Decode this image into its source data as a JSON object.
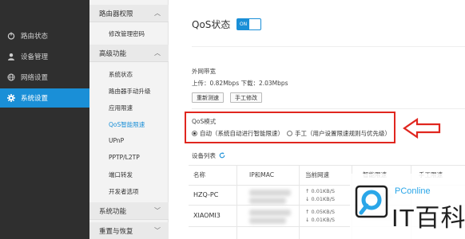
{
  "leftnav": {
    "items": [
      {
        "label": "路由状态",
        "icon": "power-icon"
      },
      {
        "label": "设备管理",
        "icon": "user-icon"
      },
      {
        "label": "网络设置",
        "icon": "globe-icon"
      },
      {
        "label": "系统设置",
        "icon": "gear-icon",
        "active": true
      }
    ],
    "active_color": "#1a8fd7"
  },
  "subnav": {
    "sections": [
      {
        "label": "路由器权限",
        "chevron": "up"
      },
      {
        "label": "高级功能",
        "chevron": "up"
      },
      {
        "label": "系统功能",
        "chevron": "down"
      },
      {
        "label": "重置与恢复",
        "chevron": "down"
      }
    ],
    "items": [
      "修改管理密码",
      "系统状态",
      "路由器手动升级",
      "应用限速",
      "QoS智能限速",
      "UPnP",
      "PPTP/L2TP",
      "端口转发",
      "开发者选项"
    ],
    "active_item": "QoS智能限速"
  },
  "main": {
    "title": "QoS状态",
    "toggle_label": "ON",
    "bandwidth": {
      "label": "外网带宽",
      "values": "上传：0.82Mbps 下载：2.03Mbps",
      "btn_retest": "重新测速",
      "btn_manual": "手工修改"
    },
    "mode": {
      "label": "QoS模式",
      "auto": "自动（系统自动进行智能限速）",
      "manual": "手工（用户设置限速规则与优先级）",
      "selected": "auto"
    },
    "devices": {
      "label": "设备列表",
      "headers": [
        "名称",
        "IP和MAC",
        "当前网速",
        "智能限速",
        "手工限速"
      ],
      "rows": [
        {
          "name": "HZQ-PC",
          "up": "↑ 0.01KB/S",
          "down": "↓ 0.01KB/S"
        },
        {
          "name": "XIAOMI3",
          "up": "↑ 0.05KB/S",
          "down": "↓ 0.01KB/S"
        }
      ]
    }
  },
  "annotation_color": "#e0261f",
  "watermark": {
    "brand": "PConline",
    "text": "IT百科",
    "brand_color": "#2aa6e8"
  }
}
